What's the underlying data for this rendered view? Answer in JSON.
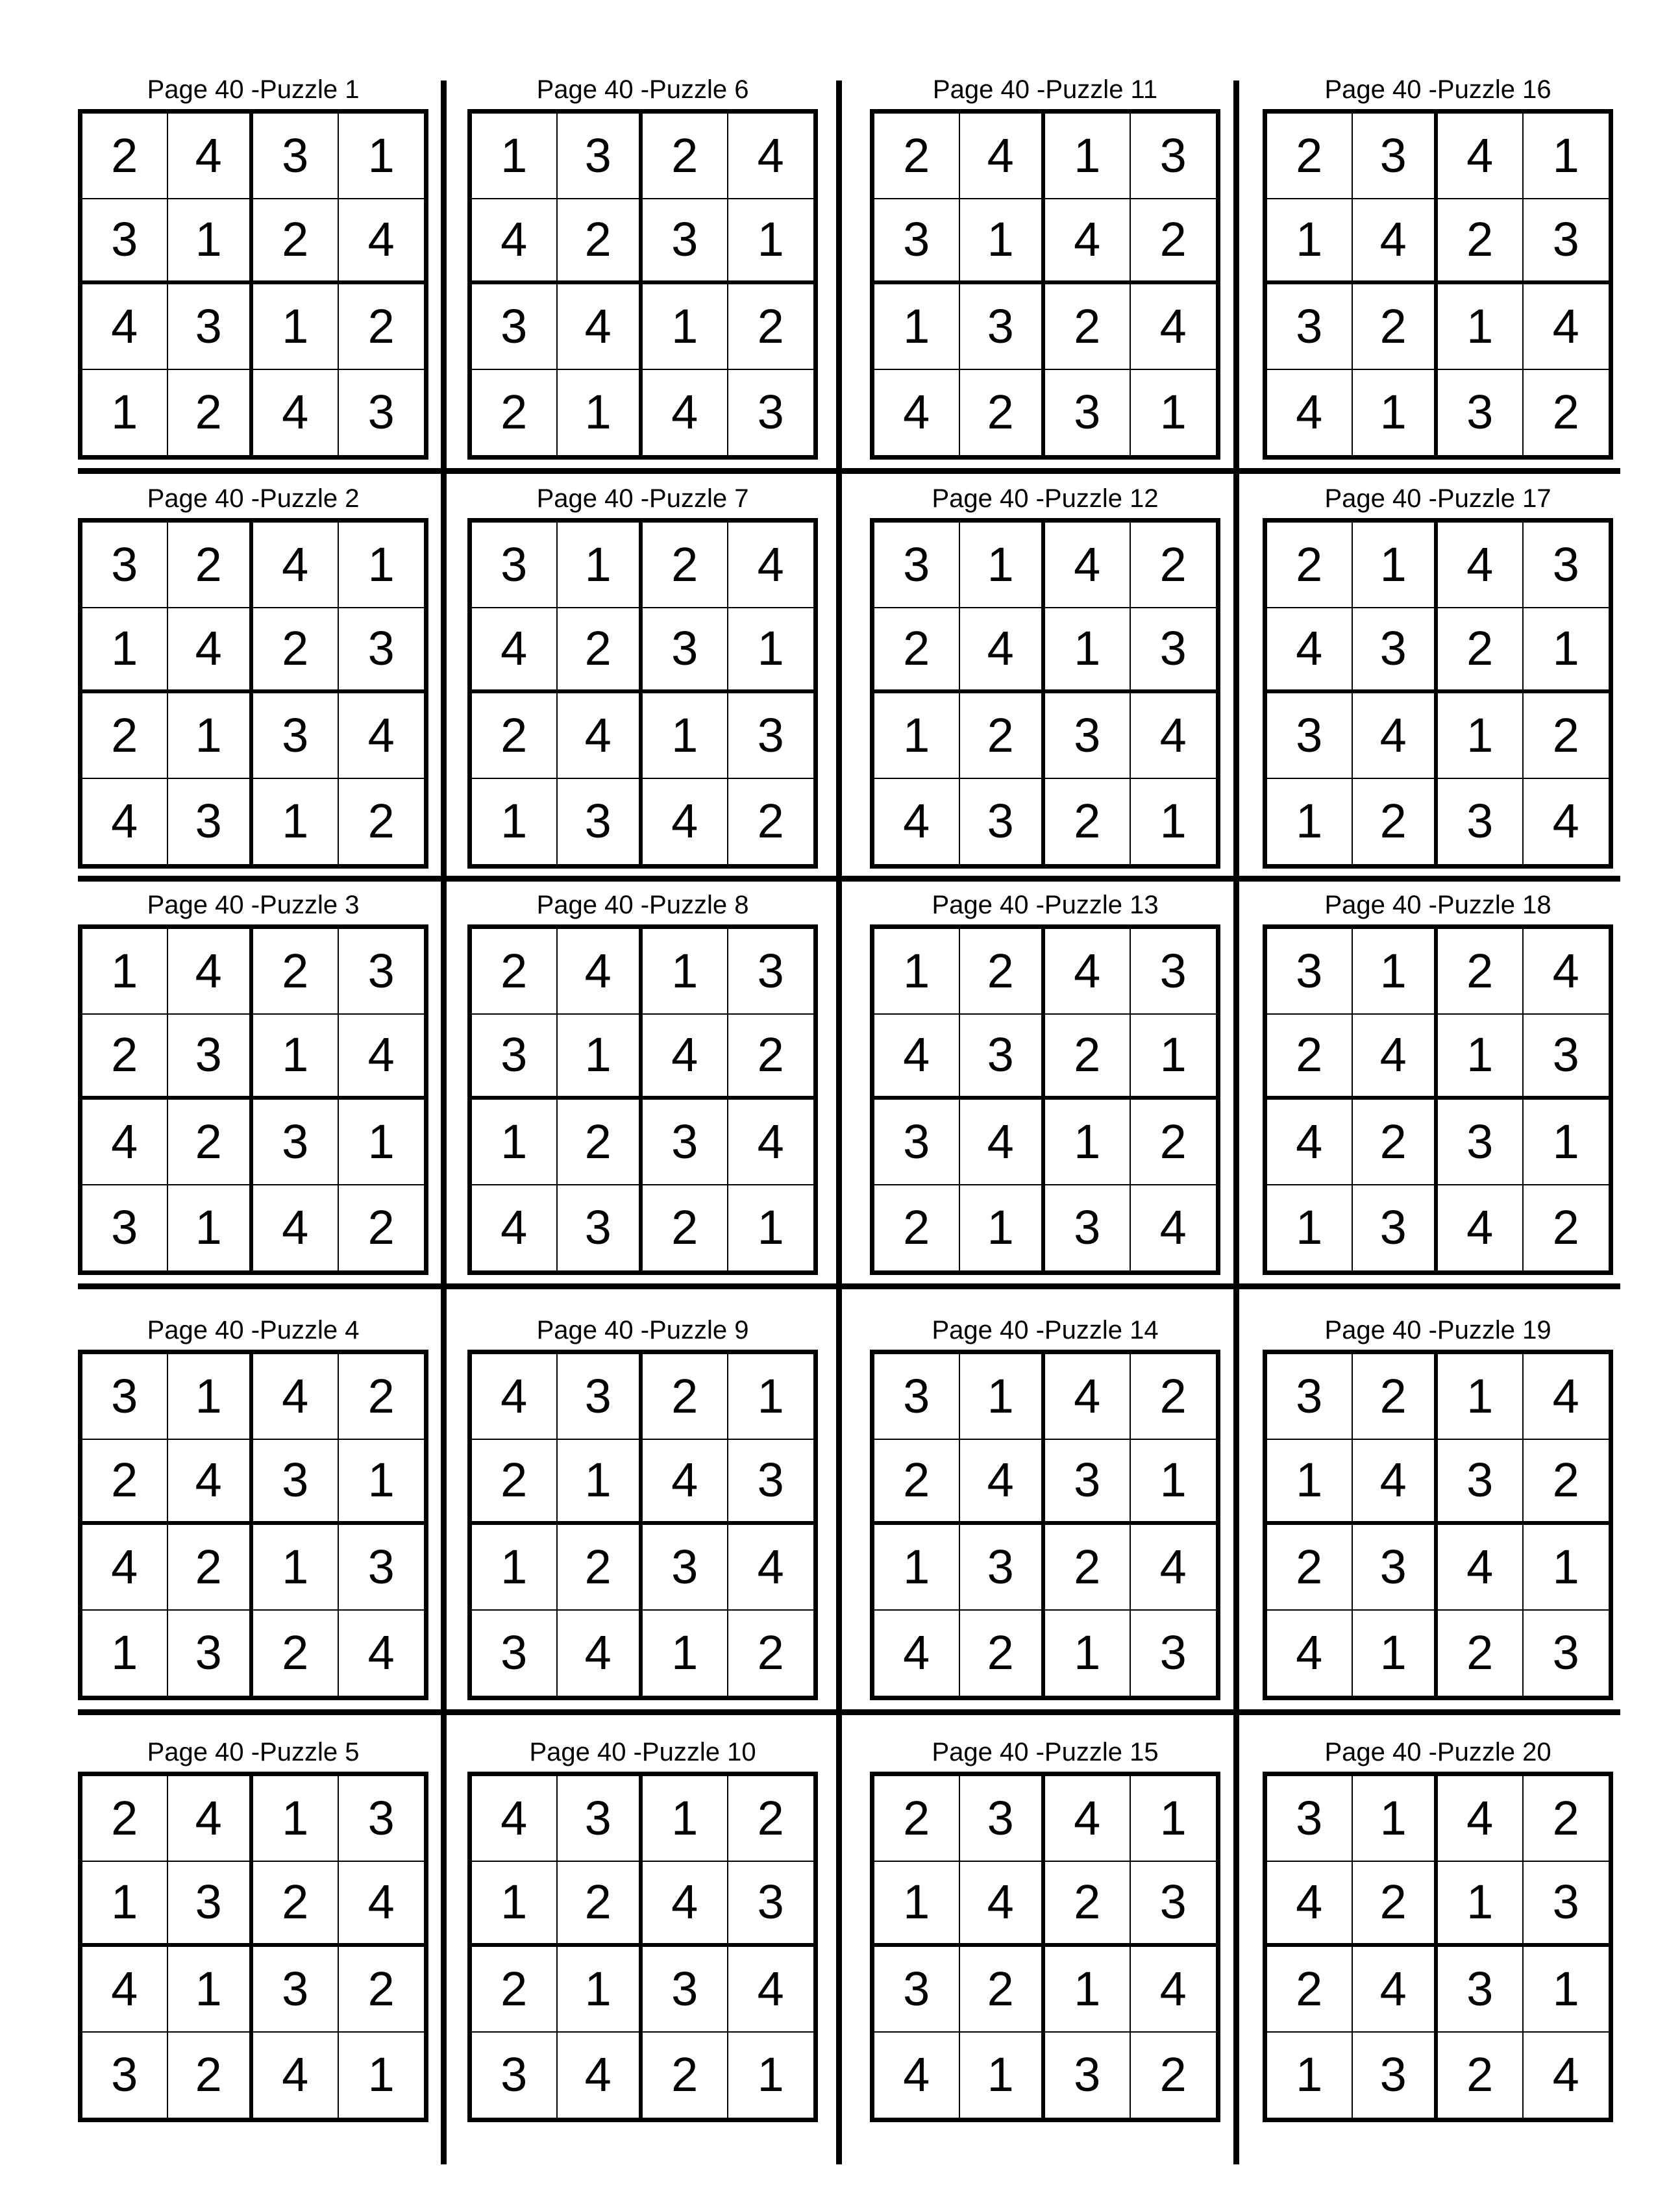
{
  "puzzles": [
    {
      "title": "Page 40 -Puzzle 1",
      "grid": [
        [
          2,
          4,
          3,
          1
        ],
        [
          3,
          1,
          2,
          4
        ],
        [
          4,
          3,
          1,
          2
        ],
        [
          1,
          2,
          4,
          3
        ]
      ]
    },
    {
      "title": "Page 40 -Puzzle 6",
      "grid": [
        [
          1,
          3,
          2,
          4
        ],
        [
          4,
          2,
          3,
          1
        ],
        [
          3,
          4,
          1,
          2
        ],
        [
          2,
          1,
          4,
          3
        ]
      ]
    },
    {
      "title": "Page 40 -Puzzle 11",
      "grid": [
        [
          2,
          4,
          1,
          3
        ],
        [
          3,
          1,
          4,
          2
        ],
        [
          1,
          3,
          2,
          4
        ],
        [
          4,
          2,
          3,
          1
        ]
      ]
    },
    {
      "title": "Page 40 -Puzzle 16",
      "grid": [
        [
          2,
          3,
          4,
          1
        ],
        [
          1,
          4,
          2,
          3
        ],
        [
          3,
          2,
          1,
          4
        ],
        [
          4,
          1,
          3,
          2
        ]
      ]
    },
    {
      "title": "Page 40 -Puzzle 2",
      "grid": [
        [
          3,
          2,
          4,
          1
        ],
        [
          1,
          4,
          2,
          3
        ],
        [
          2,
          1,
          3,
          4
        ],
        [
          4,
          3,
          1,
          2
        ]
      ]
    },
    {
      "title": "Page 40 -Puzzle 7",
      "grid": [
        [
          3,
          1,
          2,
          4
        ],
        [
          4,
          2,
          3,
          1
        ],
        [
          2,
          4,
          1,
          3
        ],
        [
          1,
          3,
          4,
          2
        ]
      ]
    },
    {
      "title": "Page 40 -Puzzle 12",
      "grid": [
        [
          3,
          1,
          4,
          2
        ],
        [
          2,
          4,
          1,
          3
        ],
        [
          1,
          2,
          3,
          4
        ],
        [
          4,
          3,
          2,
          1
        ]
      ]
    },
    {
      "title": "Page 40 -Puzzle 17",
      "grid": [
        [
          2,
          1,
          4,
          3
        ],
        [
          4,
          3,
          2,
          1
        ],
        [
          3,
          4,
          1,
          2
        ],
        [
          1,
          2,
          3,
          4
        ]
      ]
    },
    {
      "title": "Page 40 -Puzzle 3",
      "grid": [
        [
          1,
          4,
          2,
          3
        ],
        [
          2,
          3,
          1,
          4
        ],
        [
          4,
          2,
          3,
          1
        ],
        [
          3,
          1,
          4,
          2
        ]
      ]
    },
    {
      "title": "Page 40 -Puzzle 8",
      "grid": [
        [
          2,
          4,
          1,
          3
        ],
        [
          3,
          1,
          4,
          2
        ],
        [
          1,
          2,
          3,
          4
        ],
        [
          4,
          3,
          2,
          1
        ]
      ]
    },
    {
      "title": "Page 40 -Puzzle 13",
      "grid": [
        [
          1,
          2,
          4,
          3
        ],
        [
          4,
          3,
          2,
          1
        ],
        [
          3,
          4,
          1,
          2
        ],
        [
          2,
          1,
          3,
          4
        ]
      ]
    },
    {
      "title": "Page 40 -Puzzle 18",
      "grid": [
        [
          3,
          1,
          2,
          4
        ],
        [
          2,
          4,
          1,
          3
        ],
        [
          4,
          2,
          3,
          1
        ],
        [
          1,
          3,
          4,
          2
        ]
      ]
    },
    {
      "title": "Page 40 -Puzzle 4",
      "grid": [
        [
          3,
          1,
          4,
          2
        ],
        [
          2,
          4,
          3,
          1
        ],
        [
          4,
          2,
          1,
          3
        ],
        [
          1,
          3,
          2,
          4
        ]
      ]
    },
    {
      "title": "Page 40 -Puzzle 9",
      "grid": [
        [
          4,
          3,
          2,
          1
        ],
        [
          2,
          1,
          4,
          3
        ],
        [
          1,
          2,
          3,
          4
        ],
        [
          3,
          4,
          1,
          2
        ]
      ]
    },
    {
      "title": "Page 40 -Puzzle 14",
      "grid": [
        [
          3,
          1,
          4,
          2
        ],
        [
          2,
          4,
          3,
          1
        ],
        [
          1,
          3,
          2,
          4
        ],
        [
          4,
          2,
          1,
          3
        ]
      ]
    },
    {
      "title": "Page 40 -Puzzle 19",
      "grid": [
        [
          3,
          2,
          1,
          4
        ],
        [
          1,
          4,
          3,
          2
        ],
        [
          2,
          3,
          4,
          1
        ],
        [
          4,
          1,
          2,
          3
        ]
      ]
    },
    {
      "title": "Page 40 -Puzzle 5",
      "grid": [
        [
          2,
          4,
          1,
          3
        ],
        [
          1,
          3,
          2,
          4
        ],
        [
          4,
          1,
          3,
          2
        ],
        [
          3,
          2,
          4,
          1
        ]
      ]
    },
    {
      "title": "Page 40 -Puzzle 10",
      "grid": [
        [
          4,
          3,
          1,
          2
        ],
        [
          1,
          2,
          4,
          3
        ],
        [
          2,
          1,
          3,
          4
        ],
        [
          3,
          4,
          2,
          1
        ]
      ]
    },
    {
      "title": "Page 40 -Puzzle 15",
      "grid": [
        [
          2,
          3,
          4,
          1
        ],
        [
          1,
          4,
          2,
          3
        ],
        [
          3,
          2,
          1,
          4
        ],
        [
          4,
          1,
          3,
          2
        ]
      ]
    },
    {
      "title": "Page 40 -Puzzle 20",
      "grid": [
        [
          3,
          1,
          4,
          2
        ],
        [
          4,
          2,
          1,
          3
        ],
        [
          2,
          4,
          3,
          1
        ],
        [
          1,
          3,
          2,
          4
        ]
      ]
    }
  ]
}
